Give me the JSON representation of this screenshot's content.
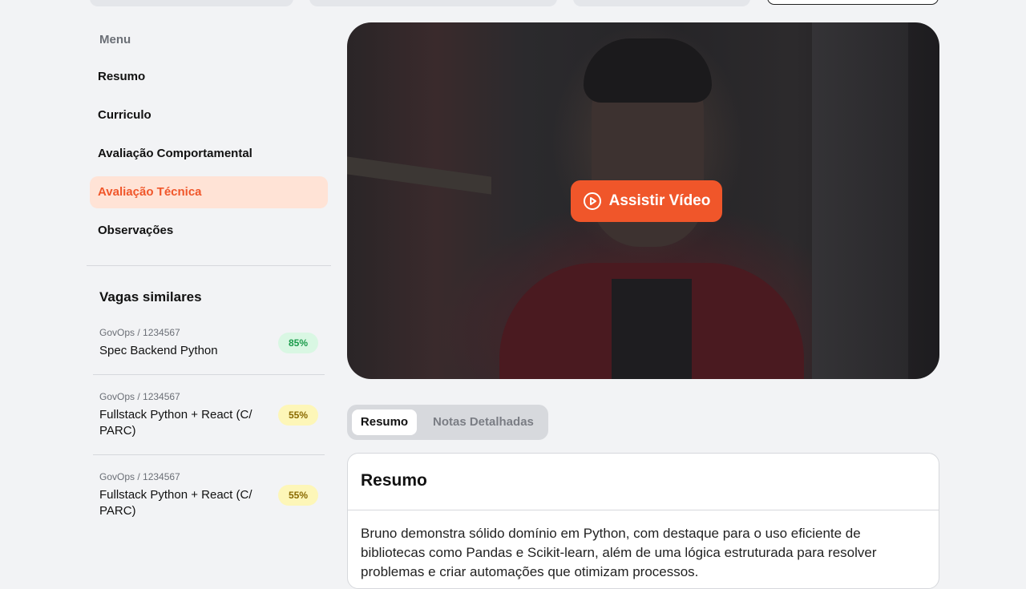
{
  "menu": {
    "title": "Menu",
    "items": [
      {
        "label": "Resumo",
        "active": false
      },
      {
        "label": "Curriculo",
        "active": false
      },
      {
        "label": "Avaliação Comportamental",
        "active": false
      },
      {
        "label": "Avaliação Técnica",
        "active": true
      },
      {
        "label": "Observações",
        "active": false
      }
    ]
  },
  "similar_jobs": {
    "title": "Vagas similares",
    "items": [
      {
        "org": "GovOps / 1234567",
        "name": "Spec Backend Python",
        "match": "85%",
        "match_color": "#1a9b4b",
        "match_bg": "#d9f7e3"
      },
      {
        "org": "GovOps / 1234567",
        "name": "Fullstack Python + React (C/ PARC)",
        "match": "55%",
        "match_color": "#8a6a00",
        "match_bg": "#fdf6b8"
      },
      {
        "org": "GovOps / 1234567",
        "name": "Fullstack Python + React (C/ PARC)",
        "match": "55%",
        "match_color": "#8a6a00",
        "match_bg": "#fdf6b8"
      }
    ]
  },
  "video": {
    "button_label": "Assistir Vídeo",
    "button_icon": "play-circle-icon",
    "accent": "#f0562a"
  },
  "tabs": {
    "active": "Resumo",
    "inactive": "Notas Detalhadas"
  },
  "summary_card": {
    "title": "Resumo",
    "text": "Bruno demonstra sólido domínio em Python, com destaque para o uso eficiente de bibliotecas como Pandas e Scikit-learn, além de uma lógica estruturada para resolver problemas e criar automações que otimizam processos."
  }
}
